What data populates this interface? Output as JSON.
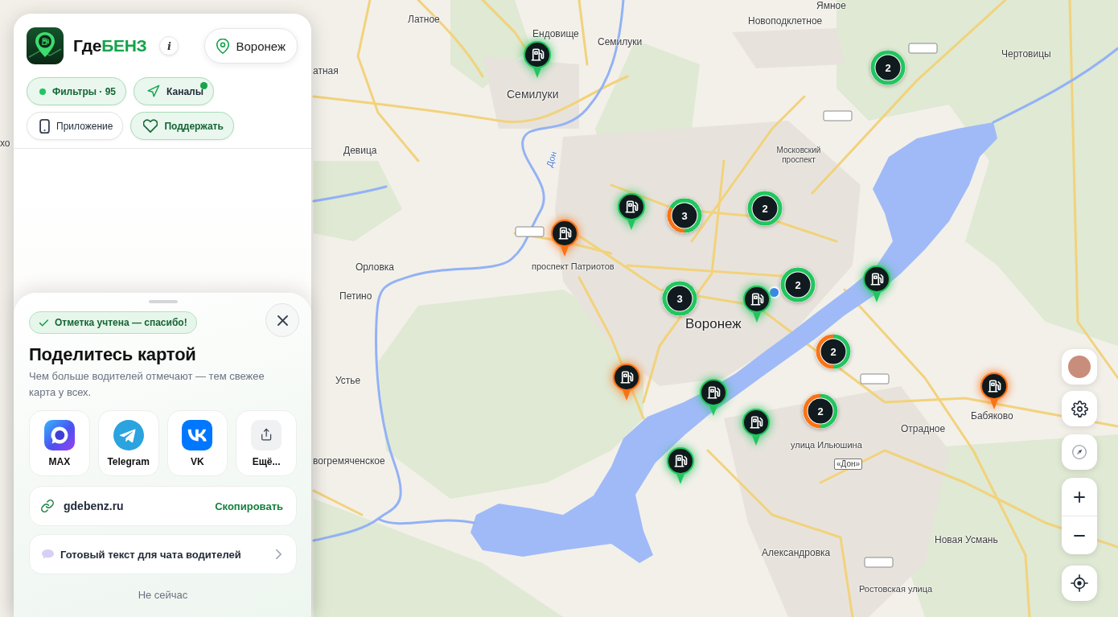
{
  "header": {
    "brand": {
      "prefix": "Где",
      "accent": "БЕНЗ"
    },
    "info_button": "i",
    "city_button": "Воронеж"
  },
  "chips": [
    {
      "kind": "filters",
      "label": "Фильтры · 95",
      "highlighted": true,
      "badge": false
    },
    {
      "kind": "channels",
      "label": "Каналы",
      "highlighted": true,
      "badge": true
    },
    {
      "kind": "app",
      "label": "Приложение",
      "highlighted": false,
      "badge": false
    },
    {
      "kind": "support",
      "label": "Поддержать",
      "highlighted": true,
      "badge": false
    }
  ],
  "share_sheet": {
    "toast": "Отметка учтена — спасибо!",
    "title": "Поделитесь картой",
    "description": "Чем больше водителей отмечают — тем свежее карта у всех.",
    "targets": [
      {
        "kind": "max",
        "label": "MAX"
      },
      {
        "kind": "telegram",
        "label": "Telegram"
      },
      {
        "kind": "vk",
        "label": "VK"
      },
      {
        "kind": "more",
        "label": "Ещё..."
      }
    ],
    "link": {
      "url": "gdebenz.ru",
      "action": "Скопировать"
    },
    "chat_text": "Готовый текст для чата водителей",
    "dismiss": "Не сейчас"
  },
  "map": {
    "labels": [
      {
        "text": "Ямное",
        "kind": "village"
      },
      {
        "text": "Латное",
        "kind": "village"
      },
      {
        "text": "Новоподклетное",
        "kind": "village"
      },
      {
        "text": "Ендовище",
        "kind": "village"
      },
      {
        "text": "Семилуки",
        "kind": "village"
      },
      {
        "text": "Чертовицы",
        "kind": "village"
      },
      {
        "text": "атная",
        "kind": "village"
      },
      {
        "text": "Семилуки",
        "kind": "town"
      },
      {
        "text": "хо",
        "kind": "village"
      },
      {
        "text": "Девица",
        "kind": "village"
      },
      {
        "text": "Московский проспект",
        "kind": "district"
      },
      {
        "text": "Дон",
        "kind": "river"
      },
      {
        "text": "Орловка",
        "kind": "village"
      },
      {
        "text": "проспект Патриотов",
        "kind": "street"
      },
      {
        "text": "Петино",
        "kind": "village"
      },
      {
        "text": "Воронеж",
        "kind": "city"
      },
      {
        "text": "Устье",
        "kind": "village"
      },
      {
        "text": "Бабяково",
        "kind": "village"
      },
      {
        "text": "Отрадное",
        "kind": "village"
      },
      {
        "text": "улица Ильюшина",
        "kind": "street"
      },
      {
        "text": "вогремяченское",
        "kind": "village"
      },
      {
        "text": "«Дон»",
        "kind": "road"
      },
      {
        "text": "Новая Усмань",
        "kind": "village"
      },
      {
        "text": "Александровка",
        "kind": "village"
      },
      {
        "text": "Ростовская улица",
        "kind": "street"
      }
    ],
    "markers": [
      {
        "kind": "station",
        "color": "#22c55e"
      },
      {
        "kind": "cluster",
        "count": "2",
        "segments": [
          {
            "color": "#22c55e"
          },
          {
            "color": "#22c55e"
          }
        ]
      },
      {
        "kind": "station",
        "color": "#22c55e"
      },
      {
        "kind": "cluster",
        "count": "2",
        "segments": [
          {
            "color": "#22c55e"
          },
          {
            "color": "#22c55e"
          }
        ]
      },
      {
        "kind": "cluster",
        "count": "3",
        "segments": [
          {
            "color": "#f97316"
          },
          {
            "color": "#22c55e"
          },
          {
            "color": "#22c55e"
          }
        ]
      },
      {
        "kind": "station",
        "color": "#f97316"
      },
      {
        "kind": "station",
        "color": "#22c55e"
      },
      {
        "kind": "cluster",
        "count": "2",
        "segments": [
          {
            "color": "#22c55e"
          },
          {
            "color": "#22c55e"
          }
        ]
      },
      {
        "kind": "station",
        "color": "#22c55e"
      },
      {
        "kind": "cluster",
        "count": "3",
        "segments": [
          {
            "color": "#22c55e"
          },
          {
            "color": "#22c55e"
          },
          {
            "color": "#22c55e"
          }
        ]
      },
      {
        "kind": "cluster",
        "count": "2",
        "segments": [
          {
            "color": "#f97316"
          },
          {
            "color": "#22c55e"
          }
        ]
      },
      {
        "kind": "station",
        "color": "#f97316"
      },
      {
        "kind": "station",
        "color": "#f97316"
      },
      {
        "kind": "station",
        "color": "#22c55e"
      },
      {
        "kind": "cluster",
        "count": "2",
        "segments": [
          {
            "color": "#f97316"
          },
          {
            "color": "#22c55e"
          }
        ]
      },
      {
        "kind": "station",
        "color": "#22c55e"
      },
      {
        "kind": "station",
        "color": "#22c55e"
      }
    ]
  }
}
